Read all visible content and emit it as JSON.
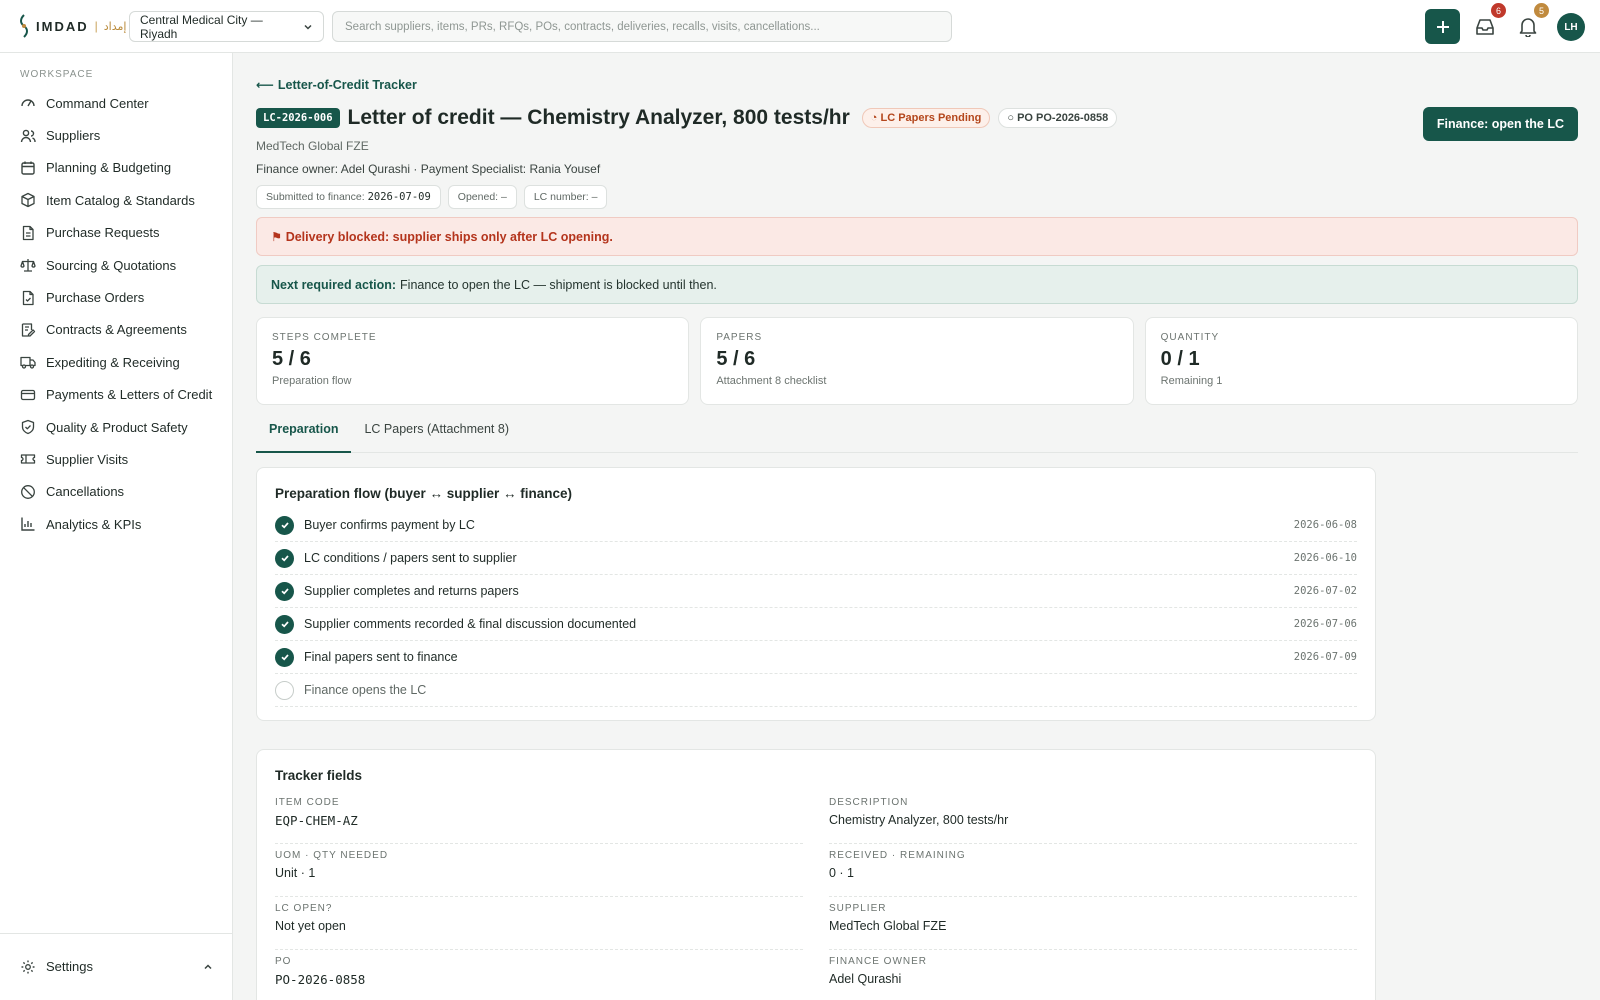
{
  "brand": {
    "name": "IMDAD",
    "separator": "|",
    "arabic": "إمداد"
  },
  "header": {
    "org_select": "Central Medical City — Riyadh",
    "search_placeholder": "Search suppliers, items, PRs, RFQs, POs, contracts, deliveries, recalls, visits, cancellations...",
    "inbox_count": "6",
    "notifications_count": "5",
    "avatar_initials": "LH"
  },
  "sidebar": {
    "section_label": "WORKSPACE",
    "items": [
      {
        "label": "Command Center",
        "icon": "gauge-icon"
      },
      {
        "label": "Suppliers",
        "icon": "users-icon"
      },
      {
        "label": "Planning & Budgeting",
        "icon": "calendar-icon"
      },
      {
        "label": "Item Catalog & Standards",
        "icon": "box-icon"
      },
      {
        "label": "Purchase Requests",
        "icon": "document-icon"
      },
      {
        "label": "Sourcing & Quotations",
        "icon": "scale-icon"
      },
      {
        "label": "Purchase Orders",
        "icon": "document-check-icon"
      },
      {
        "label": "Contracts & Agreements",
        "icon": "contract-icon"
      },
      {
        "label": "Expediting & Receiving",
        "icon": "truck-icon"
      },
      {
        "label": "Payments & Letters of Credit",
        "icon": "credit-card-icon"
      },
      {
        "label": "Quality & Product Safety",
        "icon": "shield-check-icon"
      },
      {
        "label": "Supplier Visits",
        "icon": "ticket-icon"
      },
      {
        "label": "Cancellations",
        "icon": "ban-icon"
      },
      {
        "label": "Analytics & KPIs",
        "icon": "bar-chart-icon"
      }
    ],
    "settings_label": "Settings"
  },
  "page": {
    "back_link": "Letter-of-Credit Tracker",
    "lc_code": "LC-2026-006",
    "title": "Letter of credit — Chemistry Analyzer, 800 tests/hr",
    "status_pill": "LC Papers Pending",
    "po_pill": "PO PO-2026-0858",
    "primary_action": "Finance: open the LC",
    "supplier": "MedTech Global FZE",
    "owner_line": "Finance owner: Adel Qurashi · Payment Specialist: Rania Yousef",
    "chips": {
      "submitted_label": "Submitted to finance:",
      "submitted_value": "2026-07-09",
      "opened": "Opened: –",
      "lc_number": "LC number: –"
    },
    "alert_blocked": "Delivery blocked: supplier ships only after LC opening.",
    "next_action_label": "Next required action:",
    "next_action_text": "Finance to open the LC — shipment is blocked until then."
  },
  "stats": [
    {
      "label": "STEPS COMPLETE",
      "value": "5 / 6",
      "sub": "Preparation flow"
    },
    {
      "label": "PAPERS",
      "value": "5 / 6",
      "sub": "Attachment 8 checklist"
    },
    {
      "label": "QUANTITY",
      "value": "0 / 1",
      "sub": "Remaining 1"
    }
  ],
  "tabs": [
    "Preparation",
    "LC Papers (Attachment 8)"
  ],
  "preparation": {
    "title": "Preparation flow (buyer ↔ supplier ↔ finance)",
    "steps": [
      {
        "label": "Buyer confirms payment by LC",
        "date": "2026-06-08",
        "done": true
      },
      {
        "label": "LC conditions / papers sent to supplier",
        "date": "2026-06-10",
        "done": true
      },
      {
        "label": "Supplier completes and returns papers",
        "date": "2026-07-02",
        "done": true
      },
      {
        "label": "Supplier comments recorded & final discussion documented",
        "date": "2026-07-06",
        "done": true
      },
      {
        "label": "Final papers sent to finance",
        "date": "2026-07-09",
        "done": true
      },
      {
        "label": "Finance opens the LC",
        "date": "",
        "done": false
      }
    ]
  },
  "tracker": {
    "title": "Tracker fields",
    "fields": [
      {
        "label": "ITEM CODE",
        "value": "EQP-CHEM-AZ",
        "mono": true
      },
      {
        "label": "DESCRIPTION",
        "value": "Chemistry Analyzer, 800 tests/hr"
      },
      {
        "label": "UOM · QTY NEEDED",
        "value": "Unit · 1"
      },
      {
        "label": "RECEIVED · REMAINING",
        "value": "0 · 1"
      },
      {
        "label": "LC OPEN?",
        "value": "Not yet open"
      },
      {
        "label": "SUPPLIER",
        "value": "MedTech Global FZE"
      },
      {
        "label": "PO",
        "value": "PO-2026-0858",
        "mono": true
      },
      {
        "label": "FINANCE OWNER",
        "value": "Adel Qurashi"
      }
    ]
  },
  "colors": {
    "brand": "#17564a",
    "danger": "#b4341c",
    "badge_red": "#c0392b",
    "badge_amber": "#c08a3e"
  }
}
